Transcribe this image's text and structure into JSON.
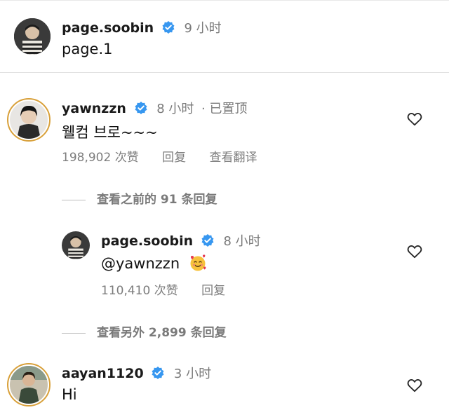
{
  "post": {
    "username": "page.soobin",
    "time": "9 小时",
    "caption": "page.1"
  },
  "comments": [
    {
      "username": "yawnzzn",
      "time": "8 小时",
      "pinned": "· 已置顶",
      "text": "웰컴 브로~~~",
      "likes": "198,902 次赞",
      "reply": "回复",
      "translate": "查看翻译"
    }
  ],
  "view_previous": "查看之前的 91 条回复",
  "reply_item": {
    "username": "page.soobin",
    "time": "8 小时",
    "text": "@yawnzzn",
    "emoji_icon": "smiling-face-with-hearts-icon",
    "likes": "110,410 次赞",
    "reply": "回复"
  },
  "view_more": "查看另外 2,899 条回复",
  "comment2": {
    "username": "aayan1120",
    "time": "3 小时",
    "text": "Hi"
  },
  "colors": {
    "verified": "#3797f0",
    "ring": "#d8a03a",
    "muted": "#7a7a7a"
  }
}
